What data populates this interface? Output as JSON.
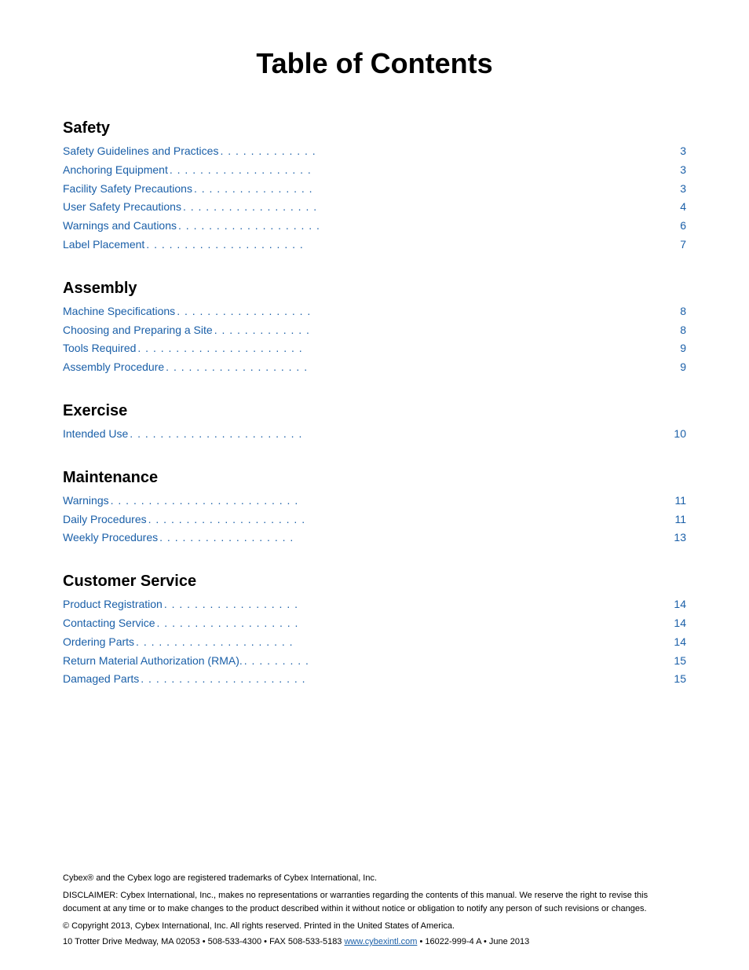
{
  "page": {
    "title": "Table of Contents"
  },
  "sections": [
    {
      "id": "safety",
      "heading": "Safety",
      "entries": [
        {
          "label": "Safety Guidelines and Practices",
          "dots": " . . . . . . . . . . . . .",
          "page": "3"
        },
        {
          "label": "Anchoring Equipment",
          "dots": " . . . . . . . . . . . . . . . . . . .",
          "page": "3"
        },
        {
          "label": "Facility Safety Precautions",
          "dots": " . . . . . . . . . . . . . . . .",
          "page": "3"
        },
        {
          "label": "User Safety Precautions",
          "dots": " . . . . . . . . . . . . . . . . . .",
          "page": "4"
        },
        {
          "label": "Warnings and Cautions",
          "dots": ". . . . . . . . . . . . . . . . . . .",
          "page": "6"
        },
        {
          "label": "Label Placement",
          "dots": " . . . . . . . . . . . . . . . . . . . . .",
          "page": "7"
        }
      ]
    },
    {
      "id": "assembly",
      "heading": "Assembly",
      "entries": [
        {
          "label": "Machine Specifications",
          "dots": " . . . . . . . . . . . . . . . . . .",
          "page": "8"
        },
        {
          "label": "Choosing and Preparing a Site",
          "dots": " . . . . . . . . . . . . .",
          "page": "8"
        },
        {
          "label": "Tools Required",
          "dots": "  . . . . . . . . . . . . . . . . . . . . . .",
          "page": "9"
        },
        {
          "label": "Assembly Procedure",
          "dots": ". . . . . . . . . . . . . . . . . . .",
          "page": "9"
        }
      ]
    },
    {
      "id": "exercise",
      "heading": "Exercise",
      "entries": [
        {
          "label": "Intended Use",
          "dots": ". . . . . . . . . . . . . . . . . . . . . . .",
          "page": "10"
        }
      ]
    },
    {
      "id": "maintenance",
      "heading": "Maintenance",
      "entries": [
        {
          "label": "Warnings",
          "dots": ". . . . . . . . . . . . . . . . . . . . . . . . .",
          "page": "11"
        },
        {
          "label": "Daily Procedures",
          "dots": ". . . . . . . . . . . . . . . . . . . . .",
          "page": "11"
        },
        {
          "label": "Weekly Procedures",
          "dots": ". . . . . . . . . . . . . . . . . .",
          "page": "13"
        }
      ]
    },
    {
      "id": "customer-service",
      "heading": "Customer Service",
      "entries": [
        {
          "label": "Product Registration",
          "dots": " . . . . . . . . . . . . . . . . . .",
          "page": "14"
        },
        {
          "label": "Contacting Service",
          "dots": "  . . . . . . . . . . . . . . . . . . .",
          "page": "14"
        },
        {
          "label": "Ordering Parts",
          "dots": ". . . . . . . . . . . . . . . . . . . . .",
          "page": "14"
        },
        {
          "label": "Return Material Authorization (RMA).",
          "dots": " . . . . . . . . .",
          "page": "15"
        },
        {
          "label": "Damaged Parts",
          "dots": " . . . . . . . . . . . . . . . . . . . . . .",
          "page": "15"
        }
      ]
    }
  ],
  "footer": {
    "trademark": "Cybex® and the Cybex logo are registered trademarks of Cybex International, Inc.",
    "disclaimer": "DISCLAIMER: Cybex International, Inc., makes no representations or warranties regarding the contents of this manual. We reserve the right to revise this document at any time or to make changes to the product described within it without notice or obligation to notify any person of such revisions or changes.",
    "copyright": "© Copyright 2013, Cybex International, Inc. All rights reserved. Printed in the United States of America.",
    "address": "10 Trotter Drive Medway, MA 02053 • 508-533-4300 • FAX 508-533-5183 ",
    "website": "www.cybexintl.com",
    "product_code": " • 16022-999-4 A • June 2013"
  }
}
